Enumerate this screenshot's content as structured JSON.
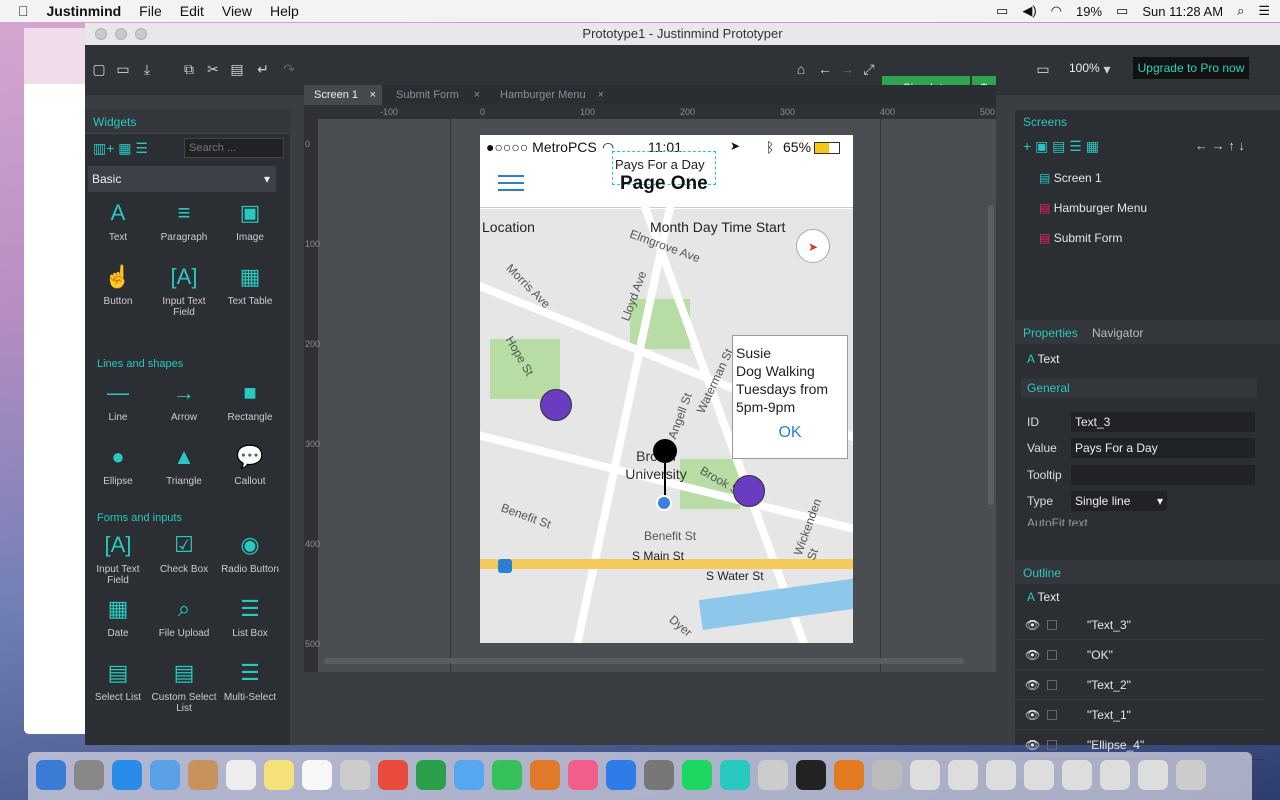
{
  "menubar": {
    "app_name": "Justinmind",
    "items": [
      "File",
      "Edit",
      "View",
      "Help"
    ],
    "battery": "19%",
    "clock": "Sun 11:28 AM"
  },
  "window": {
    "title": "Prototype1 - Justinmind Prototyper"
  },
  "toolbar": {
    "zoom": "100%",
    "upgrade_label": "Upgrade to Pro now",
    "simulate_label": "Simulate"
  },
  "tabs": [
    {
      "label": "Screen 1"
    },
    {
      "label": "Submit Form"
    },
    {
      "label": "Hamburger Menu"
    }
  ],
  "widgets": {
    "title": "Widgets",
    "search_placeholder": "Search ...",
    "category": "Basic",
    "basic": [
      "Text",
      "Paragraph",
      "Image",
      "Button",
      "Input Text Field",
      "Text Table"
    ],
    "lines_title": "Lines and shapes",
    "lines": [
      "Line",
      "Arrow",
      "Rectangle",
      "Ellipse",
      "Triangle",
      "Callout"
    ],
    "forms_title": "Forms and inputs",
    "forms": [
      "Input Text Field",
      "Check Box",
      "Radio Button",
      "Date",
      "File Upload",
      "List Box",
      "Select List",
      "Custom Select List",
      "Multi-Select"
    ]
  },
  "rulers": {
    "h": [
      "-100",
      "0",
      "100",
      "200",
      "300",
      "400",
      "500"
    ],
    "v": [
      "0",
      "100",
      "200",
      "300",
      "400",
      "500"
    ]
  },
  "phone": {
    "carrier": "●○○○○ MetroPCS",
    "time": "11:01",
    "battery": "65%",
    "subtitle": "Pays For a Day",
    "title": "Page One",
    "location_label": "Location",
    "date_label": "Month Day Time Start",
    "streets": [
      "Elmgrove Ave",
      "Morris Ave",
      "Lloyd Ave",
      "Hope St",
      "Angell St",
      "Waterman St",
      "Brook St",
      "Wickenden St",
      "Benefit St",
      "Benefit St",
      "S Main St",
      "S Water St",
      "Dyer"
    ],
    "place_label": "Brown University",
    "popup": {
      "lines": [
        "Susie",
        "Dog Walking",
        "Tuesdays from",
        "5pm-9pm"
      ],
      "ok": "OK"
    }
  },
  "screens_panel": {
    "title": "Screens",
    "items": [
      "Screen 1",
      "Hamburger Menu",
      "Submit Form"
    ]
  },
  "properties": {
    "tabs": [
      "Properties",
      "Navigator"
    ],
    "type_label": "Text",
    "section": "General",
    "fields": [
      {
        "label": "ID",
        "value": "Text_3"
      },
      {
        "label": "Value",
        "value": "Pays For a Day"
      },
      {
        "label": "Tooltip",
        "value": ""
      },
      {
        "label": "Type",
        "value": "Single line"
      }
    ],
    "autofit": "AutoFit text"
  },
  "outline": {
    "title": "Outline",
    "type_label": "Text",
    "items": [
      "\"Text_3\"",
      "\"OK\"",
      "\"Text_2\"",
      "\"Text_1\"",
      "\"Ellipse_4\""
    ]
  },
  "colors": {
    "accent": "#28c9c0",
    "simulate": "#2ea44f",
    "pin": "#6a3cbf"
  }
}
